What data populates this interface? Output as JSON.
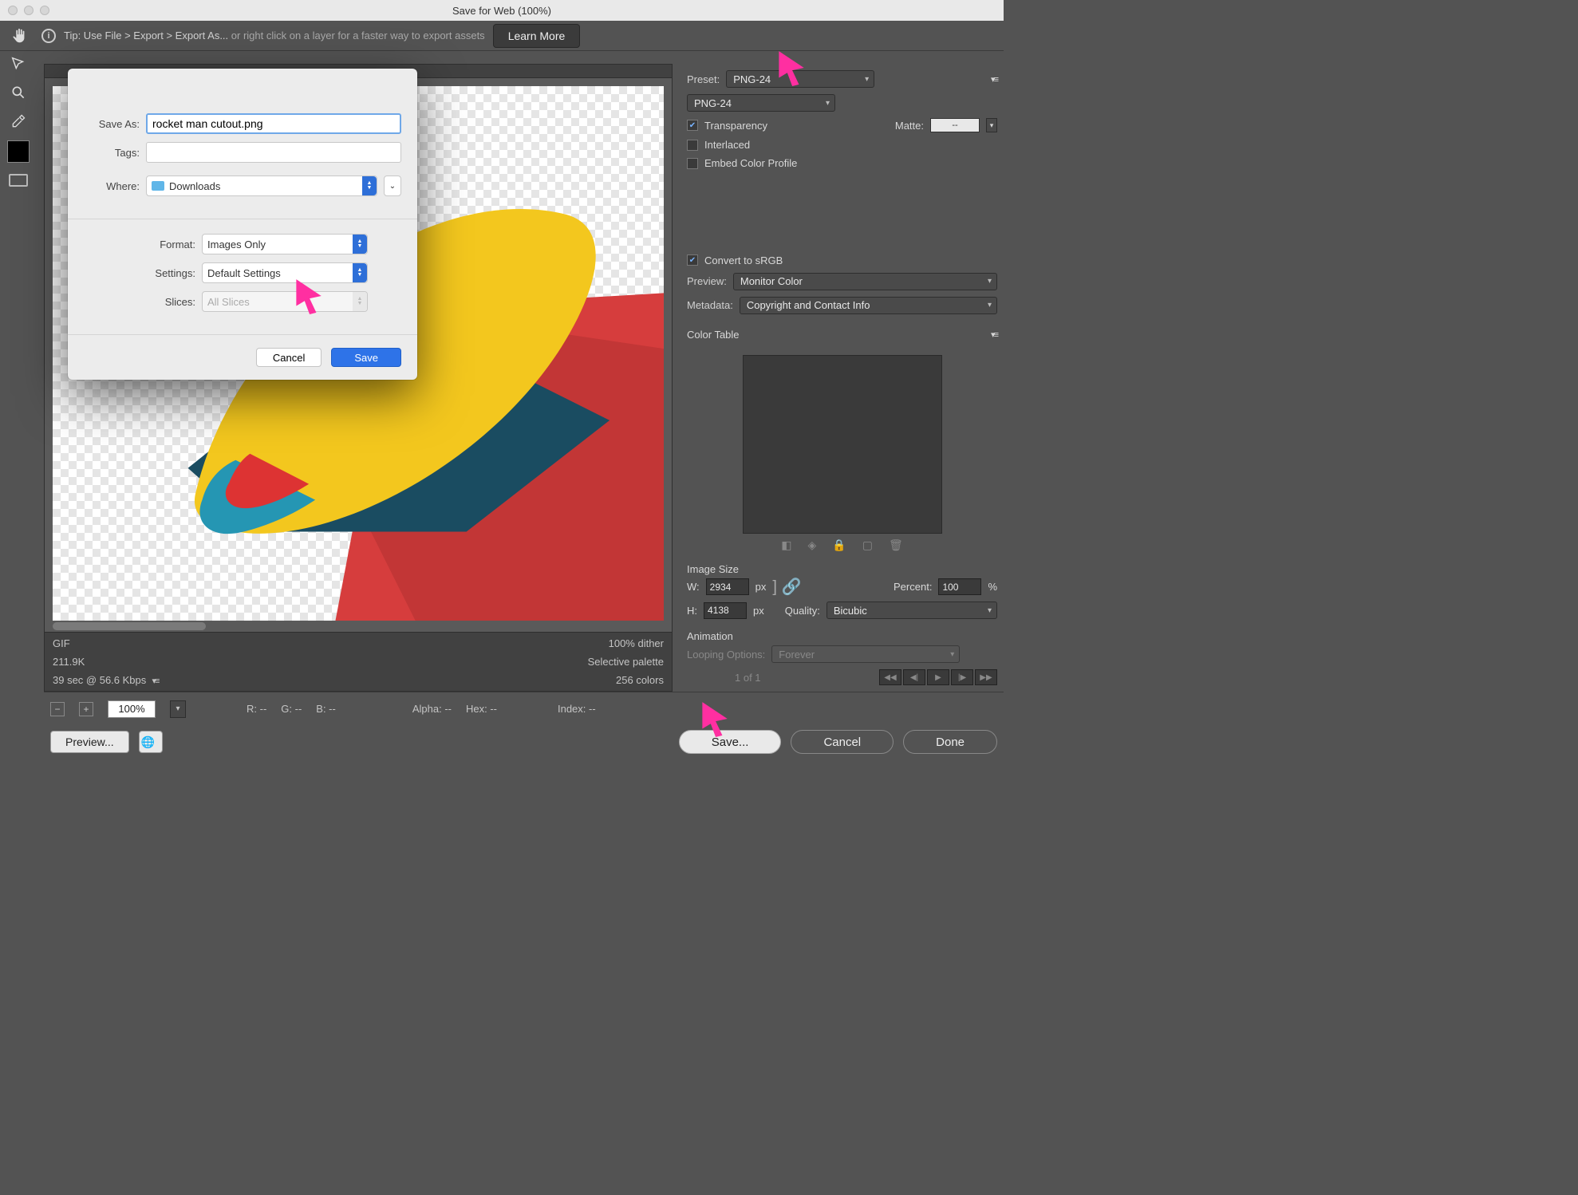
{
  "window": {
    "title": "Save for Web (100%)"
  },
  "tipbar": {
    "prefix": "Tip: Use File > Export > Export As...",
    "suffix": " or right click on a layer for a faster way to export assets",
    "learn_more": "Learn More"
  },
  "dialog": {
    "save_as_label": "Save As:",
    "save_as_value": "rocket man cutout.png",
    "tags_label": "Tags:",
    "tags_value": "",
    "where_label": "Where:",
    "where_value": "Downloads",
    "format_label": "Format:",
    "format_value": "Images Only",
    "settings_label": "Settings:",
    "settings_value": "Default Settings",
    "slices_label": "Slices:",
    "slices_value": "All Slices",
    "cancel": "Cancel",
    "save": "Save"
  },
  "right": {
    "preset_label": "Preset:",
    "preset_value": "PNG-24",
    "format_select_value": "PNG-24",
    "transparency": "Transparency",
    "matte_label": "Matte:",
    "matte_value": "--",
    "interlaced": "Interlaced",
    "embed_profile": "Embed Color Profile",
    "convert_srgb": "Convert to sRGB",
    "preview_label": "Preview:",
    "preview_value": "Monitor Color",
    "metadata_label": "Metadata:",
    "metadata_value": "Copyright and Contact Info",
    "color_table_label": "Color Table",
    "image_size_label": "Image Size",
    "w_label": "W:",
    "w_value": "2934",
    "h_label": "H:",
    "h_value": "4138",
    "px": "px",
    "percent_label": "Percent:",
    "percent_value": "100",
    "percent_sym": "%",
    "quality_label": "Quality:",
    "quality_value": "Bicubic",
    "animation_label": "Animation",
    "looping_label": "Looping Options:",
    "looping_value": "Forever",
    "frame_counter": "1 of 1"
  },
  "info": {
    "format": "GIF",
    "size": "211.9K",
    "timing": "39 sec @ 56.6 Kbps",
    "dither": "100% dither",
    "palette": "Selective palette",
    "colors": "256 colors"
  },
  "status": {
    "zoom": "100%",
    "r": "R: --",
    "g": "G: --",
    "b": "B: --",
    "alpha": "Alpha: --",
    "hex": "Hex: --",
    "index": "Index: --"
  },
  "buttons": {
    "preview": "Preview...",
    "save": "Save...",
    "cancel": "Cancel",
    "done": "Done"
  }
}
